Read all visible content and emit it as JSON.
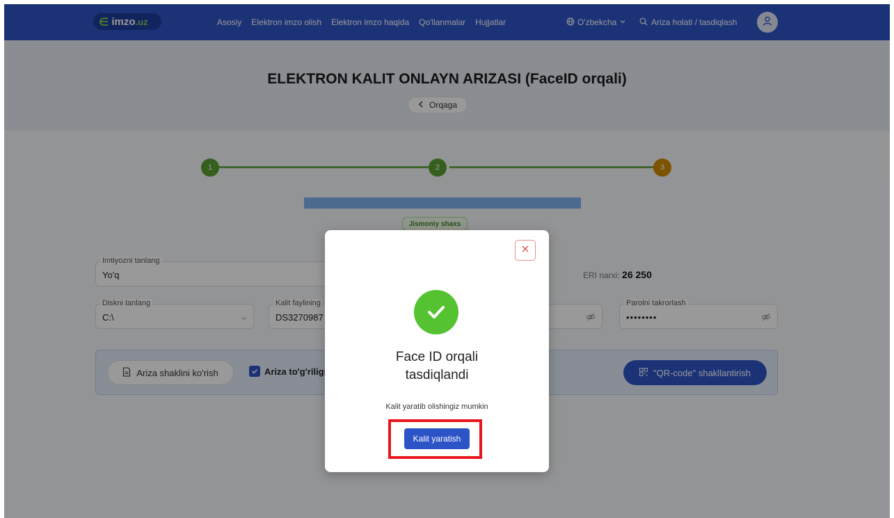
{
  "nav": {
    "logo": {
      "e": "∈",
      "imzo": "imzo",
      "uz": ".uz"
    },
    "links": [
      "Asosiy",
      "Elektron imzo olish",
      "Elektron imzo haqida",
      "Qo'llanmalar",
      "Hujjatlar"
    ],
    "language": "O'zbekcha",
    "search_link": "Ariza holati / tasdiqlash"
  },
  "header": {
    "title": "ELEKTRON KALIT ONLAYN ARIZASI (FaceID orqali)",
    "back_label": "Orqaga"
  },
  "stepper": {
    "steps": [
      "1",
      "2",
      "3"
    ],
    "colors": {
      "done": "#5a9e33",
      "active": "#d08a00",
      "line": "#6aa84f"
    }
  },
  "form": {
    "person_type": "Jismoniy shaxs",
    "benefit": {
      "label": "Imtiyozni tanlang",
      "value": "Yo'q"
    },
    "price_label": "ERI narxi:",
    "price_value": "26 250",
    "disk": {
      "label": "Diskni tanlang",
      "value": "C:\\"
    },
    "key_file": {
      "label": "Kalit faylining",
      "value": "DS3270987"
    },
    "password": {
      "value": "••••••••"
    },
    "password_repeat": {
      "label": "Parolni takrorlash",
      "value": "••••••••"
    }
  },
  "actions": {
    "view_form": "Ariza shaklini ko'rish",
    "checkbox_label": "Ariza to'g'riligi",
    "qr_button": "\"QR-code\" shakllantirish"
  },
  "modal": {
    "title_line1": "Face ID orqali",
    "title_line2": "tasdiqlandi",
    "subtitle": "Kalit yaratib olishingiz mumkin",
    "button": "Kalit yaratish"
  },
  "colors": {
    "brand": "#2d54c6",
    "success": "#55c232",
    "highlight": "#e8161c"
  }
}
